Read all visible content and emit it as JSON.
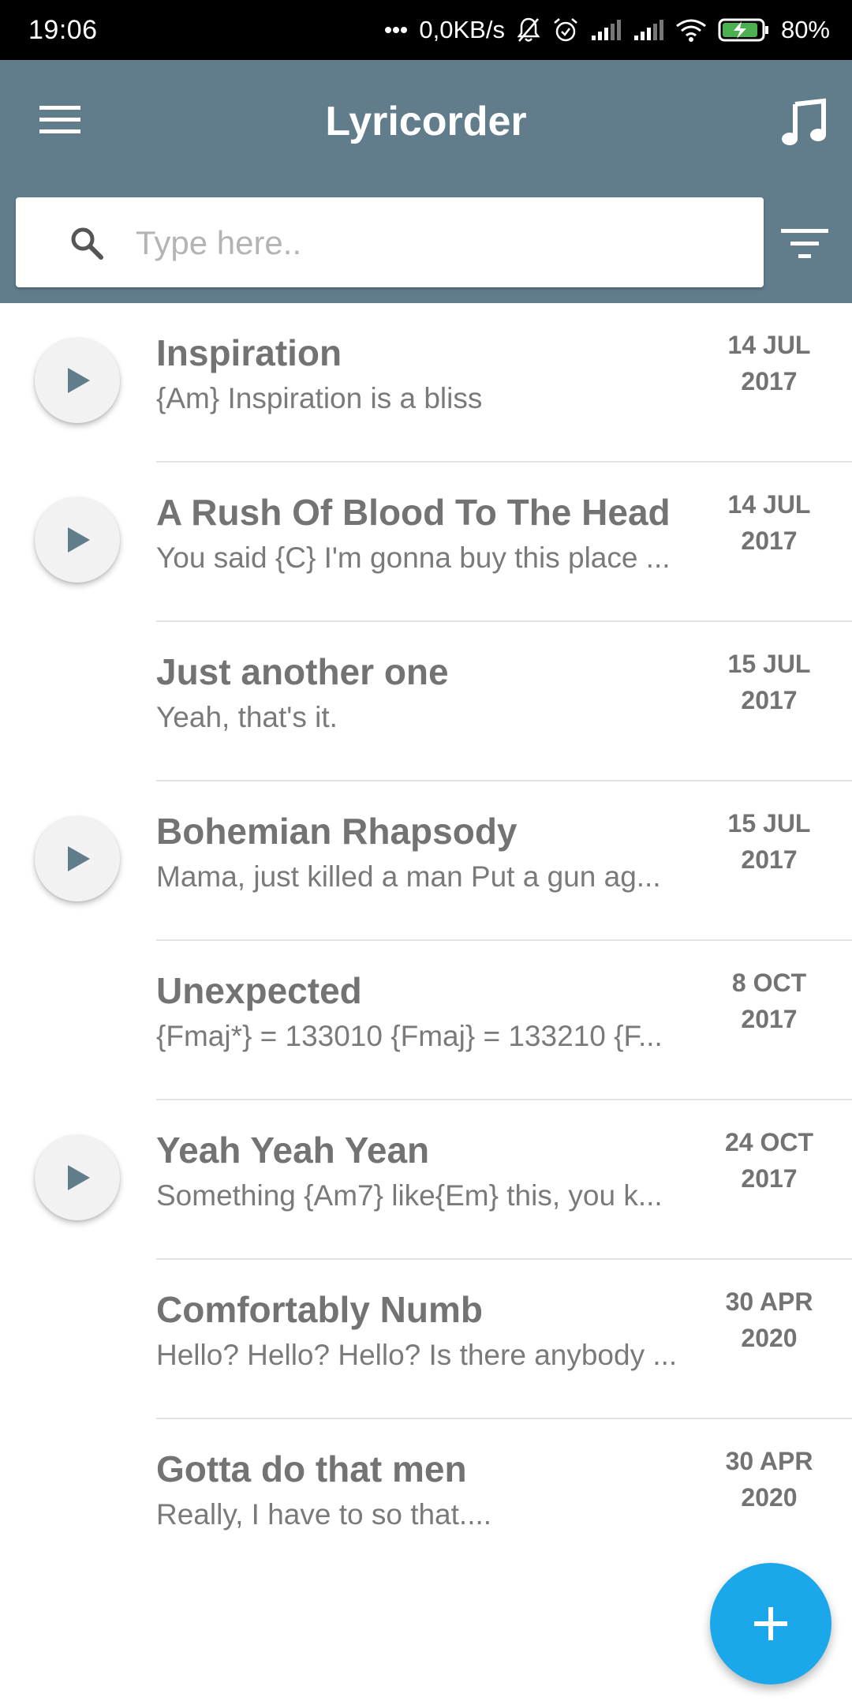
{
  "status_bar": {
    "time": "19:06",
    "network_speed": "0,0KB/s",
    "battery": "80%",
    "icons": [
      "dots-icon",
      "mute-bell-icon",
      "alarm-icon",
      "signal-icon",
      "signal-icon",
      "wifi-icon",
      "battery-charging-icon"
    ]
  },
  "app_bar": {
    "title": "Lyricorder",
    "menu_icon": "hamburger-menu-icon",
    "music_icon": "music-note-icon",
    "filter_icon": "filter-icon",
    "background_color": "#617d8c"
  },
  "search": {
    "placeholder": "Type here..",
    "value": "",
    "icon": "search-icon"
  },
  "songs": [
    {
      "title": "Inspiration",
      "preview": "{Am} Inspiration is a bliss",
      "date_line1": "14 JUL",
      "date_line2": "2017",
      "has_audio": true
    },
    {
      "title": "A Rush Of Blood To The Head",
      "preview": "You said {C} I'm gonna buy this place ...",
      "date_line1": "14 JUL",
      "date_line2": "2017",
      "has_audio": true
    },
    {
      "title": "Just another one",
      "preview": "Yeah, that's it.",
      "date_line1": "15 JUL",
      "date_line2": "2017",
      "has_audio": false
    },
    {
      "title": "Bohemian Rhapsody",
      "preview": "Mama, just killed a man Put a gun ag...",
      "date_line1": "15 JUL",
      "date_line2": "2017",
      "has_audio": true
    },
    {
      "title": "Unexpected",
      "preview": "{Fmaj*} = 133010 {Fmaj} = 133210 {F...",
      "date_line1": "8 OCT",
      "date_line2": "2017",
      "has_audio": false
    },
    {
      "title": "Yeah Yeah Yean",
      "preview": "Something {Am7} like{Em} this, you k...",
      "date_line1": "24 OCT",
      "date_line2": "2017",
      "has_audio": true
    },
    {
      "title": "Comfortably Numb",
      "preview": "Hello? Hello? Hello? Is there anybody ...",
      "date_line1": "30 APR",
      "date_line2": "2020",
      "has_audio": false
    },
    {
      "title": "Gotta do that men",
      "preview": "Really, I have to so that....",
      "date_line1": "30 APR",
      "date_line2": "2020",
      "has_audio": false
    }
  ],
  "fab": {
    "icon": "plus-icon",
    "color": "#1ba8ea"
  }
}
